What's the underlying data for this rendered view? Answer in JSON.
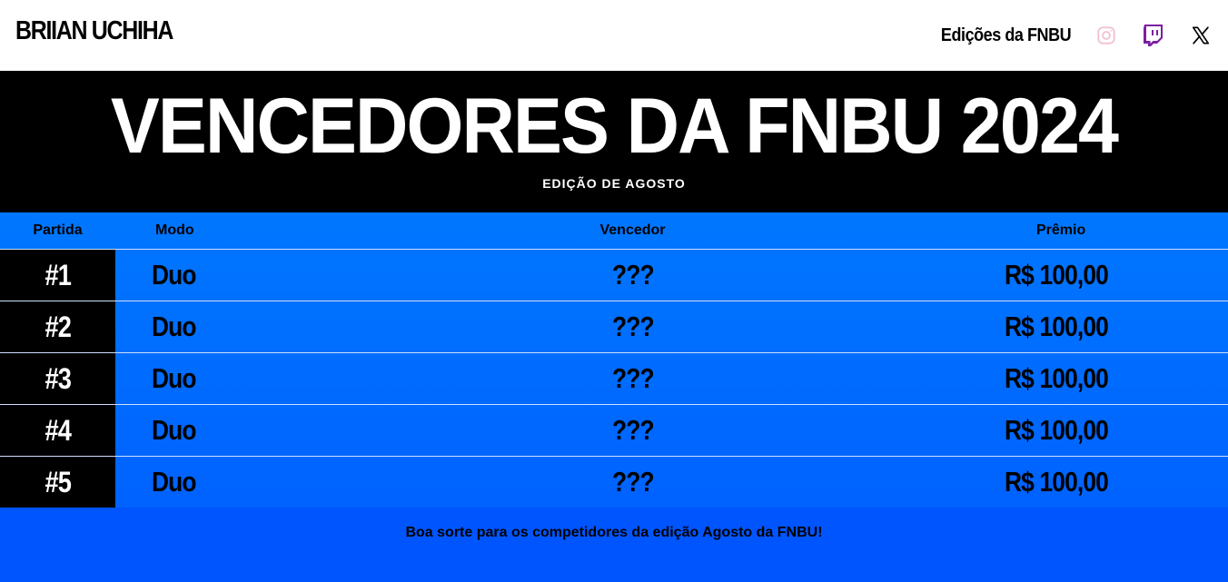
{
  "header": {
    "brand": "BRIIAN UCHIHA",
    "nav_link": "Edições da FNBU",
    "icons": [
      "instagram-icon",
      "twitch-icon",
      "x-icon"
    ],
    "colors": {
      "instagram": "#f2c1cf",
      "twitch": "#7b1fa2",
      "x": "#000000"
    }
  },
  "hero": {
    "title": "VENCEDORES DA FNBU 2024",
    "subtitle": "EDIÇÃO DE AGOSTO"
  },
  "table": {
    "headers": {
      "partida": "Partida",
      "modo": "Modo",
      "vencedor": "Vencedor",
      "premio": "Prêmio"
    },
    "rows": [
      {
        "partida": "#1",
        "modo": "Duo",
        "vencedor": "???",
        "premio": "R$ 100,00"
      },
      {
        "partida": "#2",
        "modo": "Duo",
        "vencedor": "???",
        "premio": "R$ 100,00"
      },
      {
        "partida": "#3",
        "modo": "Duo",
        "vencedor": "???",
        "premio": "R$ 100,00"
      },
      {
        "partida": "#4",
        "modo": "Duo",
        "vencedor": "???",
        "premio": "R$ 100,00"
      },
      {
        "partida": "#5",
        "modo": "Duo",
        "vencedor": "???",
        "premio": "R$ 100,00"
      }
    ]
  },
  "footer": {
    "message": "Boa sorte para os competidores da edição Agosto da FNBU!"
  },
  "colors": {
    "accent_blue": "#0077ff",
    "deep_blue": "#0055ff",
    "black": "#000000"
  }
}
